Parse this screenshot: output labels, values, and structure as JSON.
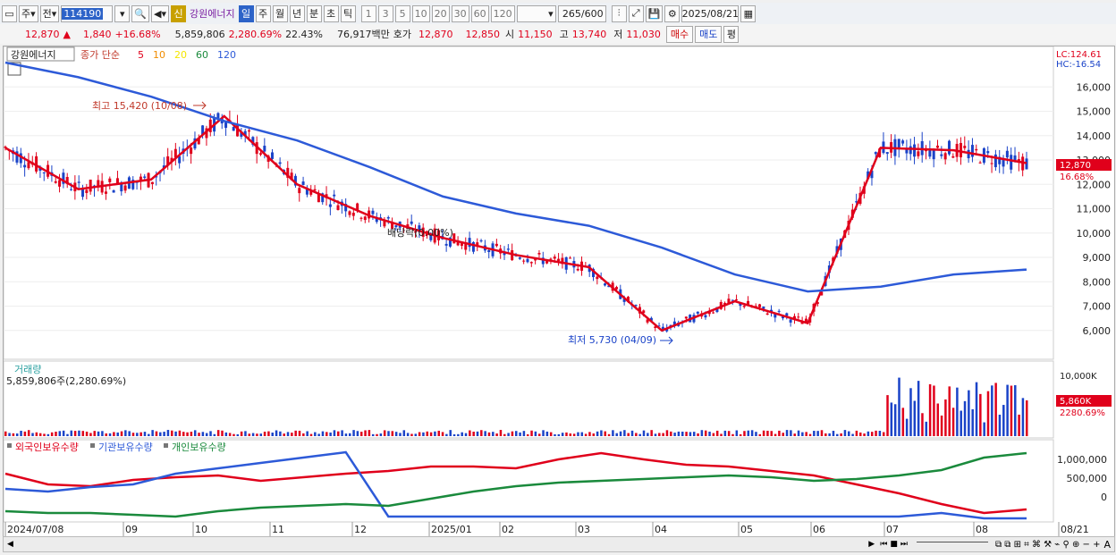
{
  "toolbar": {
    "period_label": "주",
    "type_label": "전",
    "code": "114190",
    "new_badge": "신",
    "name": "강원에너지",
    "intervals": [
      "일",
      "주",
      "월",
      "년",
      "분",
      "초",
      "틱"
    ],
    "active_interval": "일",
    "ticks": [
      "1",
      "3",
      "5",
      "10",
      "20",
      "30",
      "60",
      "120"
    ],
    "count": "265",
    "count_max": "/600",
    "date": "2025/08/21"
  },
  "quote": {
    "price": "12,870",
    "arrow": "▲",
    "change": "1,840",
    "change_pct": "+16.68%",
    "volume": "5,859,806",
    "vol_ratio": "2,280.69%",
    "turnover": "22.43%",
    "amount": "76,917백만",
    "bid_label": "호가",
    "bid1": "12,870",
    "bid2": "12,850",
    "open_label": "시",
    "open": "11,150",
    "high_label": "고",
    "high": "13,740",
    "low_label": "저",
    "low": "11,030",
    "buy_label": "매수",
    "sell_label": "매도",
    "avg_label": "평"
  },
  "chart": {
    "series_label": "강원에너지",
    "legend_prefix": "종가 단순",
    "ma_periods": [
      "5",
      "10",
      "20",
      "60",
      "120"
    ],
    "ma_colors": [
      "#e0001b",
      "#f08c00",
      "#f5e600",
      "#1a8a3c",
      "#2d5ad8"
    ],
    "lc": "LC:124.61",
    "hc": "HC:-16.54",
    "y_ticks": [
      "16,000",
      "15,000",
      "14,000",
      "13,000",
      "12,000",
      "11,000",
      "10,000",
      "9,000",
      "8,000",
      "7,000",
      "6,000"
    ],
    "price_tag": "12,870",
    "pct_tag": "16.68%",
    "high_note": "최고 15,420 (10/08)",
    "low_note": "최저 5,730 (04/09)",
    "dividend_note": "배당락(0.00%)",
    "volume_title": "거래량",
    "volume_value": "5,859,806주(2,280.69%)",
    "vol_ticks": [
      "10,000K"
    ],
    "vol_tag": "5,860K",
    "vol_pct_tag": "2280.69%",
    "holdings_legend": [
      "외국인보유수량",
      "기관보유수량",
      "개인보유수량"
    ],
    "holdings_colors": [
      "#e0001b",
      "#2d5ad8",
      "#1a8a3c"
    ],
    "hold_ticks": [
      "1,000,000",
      "500,000",
      "0"
    ],
    "x_labels": [
      "2024/07/08",
      "09",
      "10",
      "11",
      "12",
      "2025/01",
      "02",
      "03",
      "04",
      "05",
      "06",
      "07",
      "08",
      "08/21"
    ]
  },
  "chart_data": {
    "type": "line",
    "price_range": [
      5000,
      17000
    ],
    "x": [
      "2024/07",
      "2024/08",
      "2024/09",
      "2024/10",
      "2024/11",
      "2024/12",
      "2025/01",
      "2025/02",
      "2025/03",
      "2025/04",
      "2025/05",
      "2025/06",
      "2025/07",
      "2025/08",
      "2025/08/21"
    ],
    "series": [
      {
        "name": "5",
        "values": [
          13500,
          11800,
          12200,
          14800,
          12000,
          10700,
          9800,
          9100,
          8600,
          6000,
          7200,
          6300,
          13500,
          13400,
          12870
        ]
      },
      {
        "name": "120",
        "values": [
          17000,
          16400,
          15600,
          14600,
          13800,
          12700,
          11500,
          10800,
          10300,
          9400,
          8300,
          7600,
          7800,
          8300,
          8500
        ]
      }
    ],
    "high": 15420,
    "low": 5730,
    "volume_last": 5860000
  }
}
